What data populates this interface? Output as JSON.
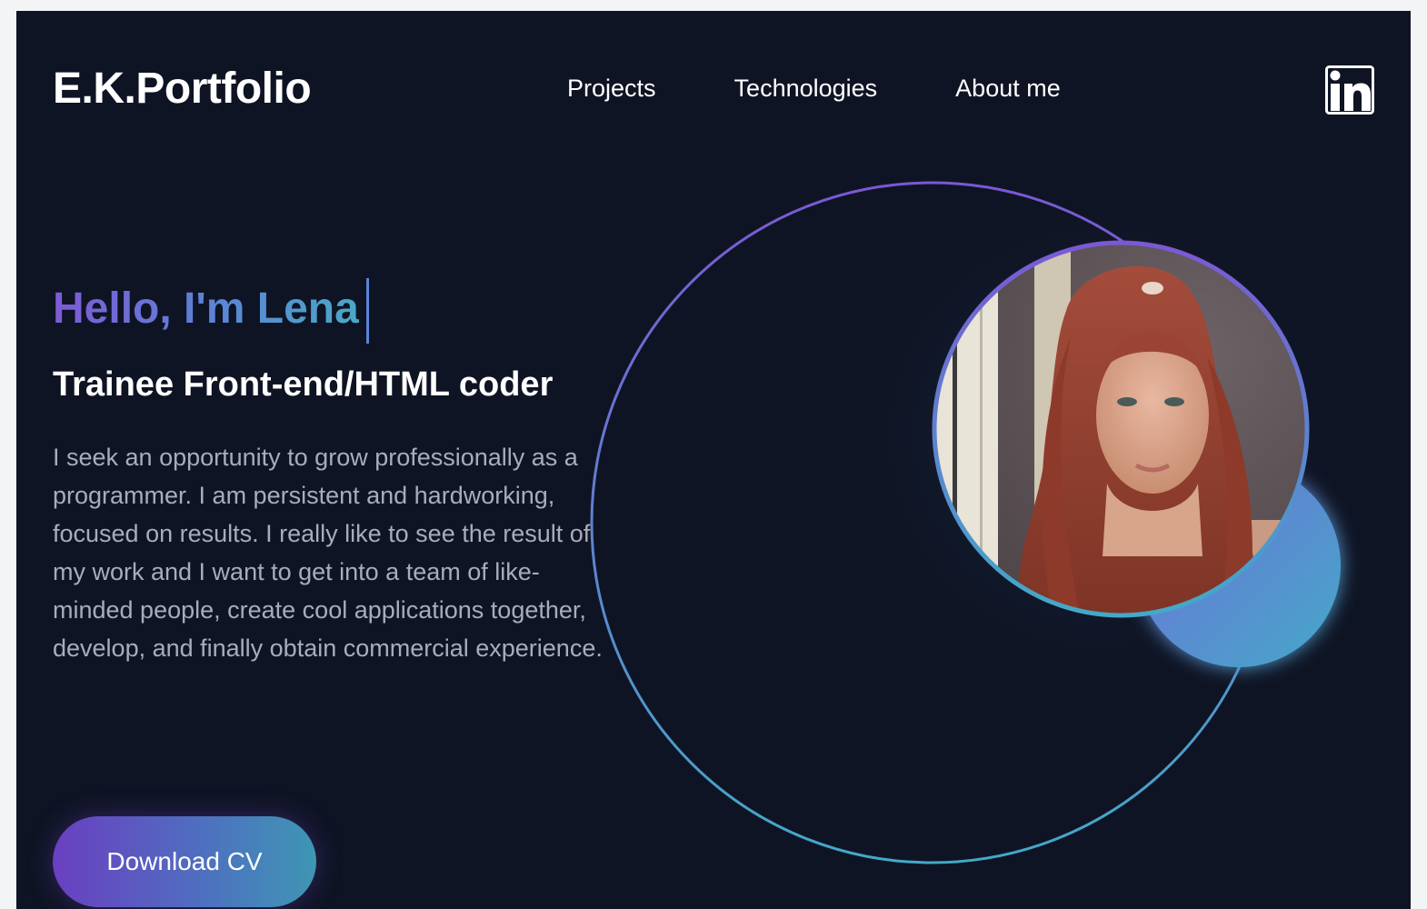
{
  "header": {
    "logo": "E.K.Portfolio",
    "nav": [
      "Projects",
      "Technologies",
      "About me"
    ],
    "social_icon": "linkedin-icon"
  },
  "hero": {
    "greeting": "Hello, I'm Lena",
    "role": "Trainee Front-end/HTML coder",
    "intro": "I seek an opportunity to grow professionally as a programmer. I am persistent and hardworking, focused on results. I really like to see the result of my work and I want to get into a team of like-minded people, create cool applications together, develop, and finally obtain commercial experience.",
    "cta": "Download CV",
    "portrait": "profile-photo"
  },
  "colors": {
    "background": "#0f1424",
    "gradient_purple": "#7e5ad6",
    "gradient_blue": "#4aa8c6",
    "text_muted": "#a9acb9",
    "text_white": "#ffffff"
  }
}
